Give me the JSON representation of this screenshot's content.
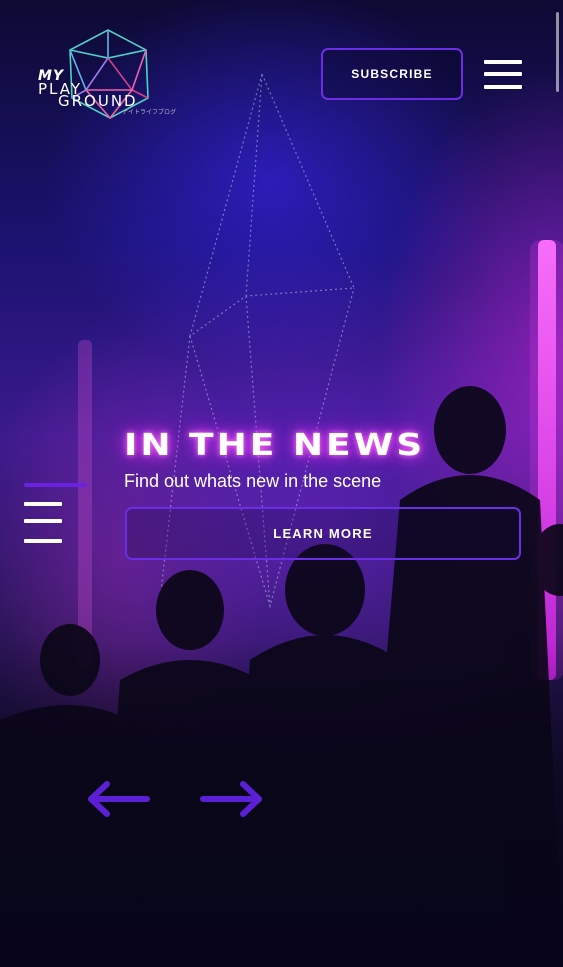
{
  "header": {
    "logo": {
      "line1": "MY",
      "line2": "PLAY",
      "line3": "GROUND",
      "tagline": "ナイトライフブログ"
    },
    "subscribe_label": "SUBSCRIBE",
    "menu_icon": "hamburger-menu-icon"
  },
  "slide": {
    "title": "IN THE NEWS",
    "subtitle": "Find out whats new in the scene",
    "cta_label": "LEARN MORE"
  },
  "slider_controls": {
    "prev_icon": "arrow-left-icon",
    "next_icon": "arrow-right-icon"
  },
  "side_nav": {
    "icon": "hamburger-menu-icon"
  },
  "colors": {
    "accent": "#6b2ee6",
    "arrow": "#5b1fd6",
    "neon": "#e040fb",
    "background": "#07051a"
  }
}
